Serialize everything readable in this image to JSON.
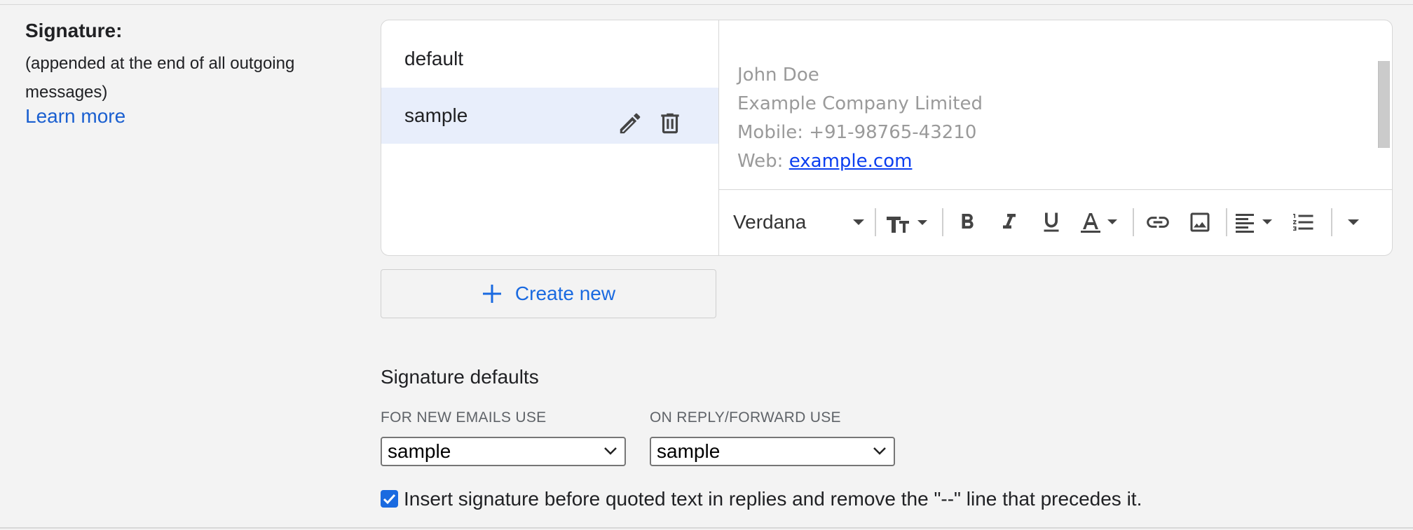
{
  "signature_section": {
    "label": "Signature:",
    "description": "(appended at the end of all outgoing messages)",
    "learn_more": "Learn more"
  },
  "signature_list": {
    "items": [
      {
        "name": "default",
        "selected": false
      },
      {
        "name": "sample",
        "selected": true
      }
    ],
    "edit_icon": "pencil-icon",
    "delete_icon": "trash-icon"
  },
  "editor": {
    "lines": [
      "John Doe",
      "Example Company Limited",
      "Mobile: +91-98765-43210"
    ],
    "web_prefix": "Web: ",
    "web_link": "example.com",
    "text_color": "#9a9a9a",
    "link_color": "#0b3ef0"
  },
  "toolbar": {
    "font": "Verdana",
    "buttons": [
      "font-size-icon",
      "bold-icon",
      "italic-icon",
      "underline-icon",
      "text-color-icon",
      "link-icon",
      "image-icon",
      "align-icon",
      "numbered-list-icon",
      "more-options-icon"
    ]
  },
  "create_new": {
    "label": "Create new",
    "icon": "plus-icon",
    "color": "#1a6ae0"
  },
  "defaults": {
    "title": "Signature defaults",
    "new_emails_label": "FOR NEW EMAILS USE",
    "new_emails_value": "sample",
    "reply_label": "ON REPLY/FORWARD USE",
    "reply_value": "sample"
  },
  "insert_option": {
    "checked": true,
    "label": "Insert signature before quoted text in replies and remove the \"--\" line that precedes it."
  },
  "colors": {
    "selected_row": "#e8eefb",
    "accent": "#1a6ae0",
    "page_background": "#f3f3f3"
  }
}
